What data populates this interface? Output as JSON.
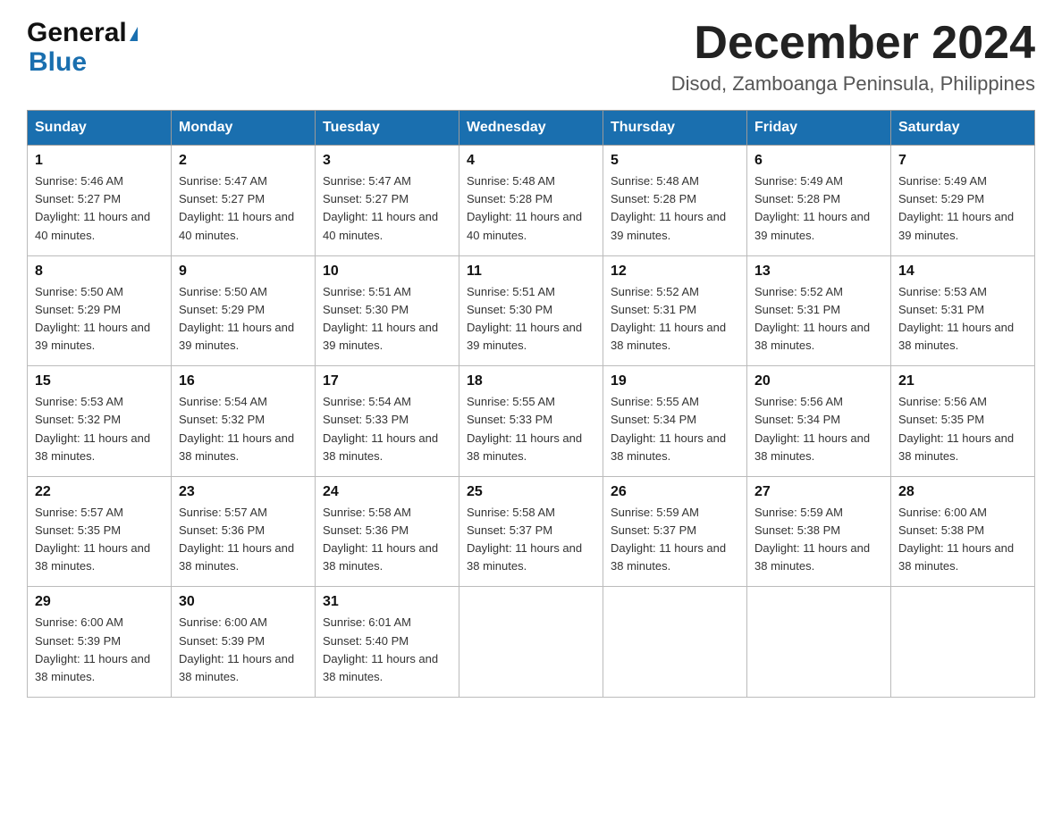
{
  "logo": {
    "general": "General",
    "blue": "Blue"
  },
  "title": "December 2024",
  "subtitle": "Disod, Zamboanga Peninsula, Philippines",
  "days_of_week": [
    "Sunday",
    "Monday",
    "Tuesday",
    "Wednesday",
    "Thursday",
    "Friday",
    "Saturday"
  ],
  "weeks": [
    [
      {
        "day": "1",
        "sunrise": "5:46 AM",
        "sunset": "5:27 PM",
        "daylight": "11 hours and 40 minutes."
      },
      {
        "day": "2",
        "sunrise": "5:47 AM",
        "sunset": "5:27 PM",
        "daylight": "11 hours and 40 minutes."
      },
      {
        "day": "3",
        "sunrise": "5:47 AM",
        "sunset": "5:27 PM",
        "daylight": "11 hours and 40 minutes."
      },
      {
        "day": "4",
        "sunrise": "5:48 AM",
        "sunset": "5:28 PM",
        "daylight": "11 hours and 40 minutes."
      },
      {
        "day": "5",
        "sunrise": "5:48 AM",
        "sunset": "5:28 PM",
        "daylight": "11 hours and 39 minutes."
      },
      {
        "day": "6",
        "sunrise": "5:49 AM",
        "sunset": "5:28 PM",
        "daylight": "11 hours and 39 minutes."
      },
      {
        "day": "7",
        "sunrise": "5:49 AM",
        "sunset": "5:29 PM",
        "daylight": "11 hours and 39 minutes."
      }
    ],
    [
      {
        "day": "8",
        "sunrise": "5:50 AM",
        "sunset": "5:29 PM",
        "daylight": "11 hours and 39 minutes."
      },
      {
        "day": "9",
        "sunrise": "5:50 AM",
        "sunset": "5:29 PM",
        "daylight": "11 hours and 39 minutes."
      },
      {
        "day": "10",
        "sunrise": "5:51 AM",
        "sunset": "5:30 PM",
        "daylight": "11 hours and 39 minutes."
      },
      {
        "day": "11",
        "sunrise": "5:51 AM",
        "sunset": "5:30 PM",
        "daylight": "11 hours and 39 minutes."
      },
      {
        "day": "12",
        "sunrise": "5:52 AM",
        "sunset": "5:31 PM",
        "daylight": "11 hours and 38 minutes."
      },
      {
        "day": "13",
        "sunrise": "5:52 AM",
        "sunset": "5:31 PM",
        "daylight": "11 hours and 38 minutes."
      },
      {
        "day": "14",
        "sunrise": "5:53 AM",
        "sunset": "5:31 PM",
        "daylight": "11 hours and 38 minutes."
      }
    ],
    [
      {
        "day": "15",
        "sunrise": "5:53 AM",
        "sunset": "5:32 PM",
        "daylight": "11 hours and 38 minutes."
      },
      {
        "day": "16",
        "sunrise": "5:54 AM",
        "sunset": "5:32 PM",
        "daylight": "11 hours and 38 minutes."
      },
      {
        "day": "17",
        "sunrise": "5:54 AM",
        "sunset": "5:33 PM",
        "daylight": "11 hours and 38 minutes."
      },
      {
        "day": "18",
        "sunrise": "5:55 AM",
        "sunset": "5:33 PM",
        "daylight": "11 hours and 38 minutes."
      },
      {
        "day": "19",
        "sunrise": "5:55 AM",
        "sunset": "5:34 PM",
        "daylight": "11 hours and 38 minutes."
      },
      {
        "day": "20",
        "sunrise": "5:56 AM",
        "sunset": "5:34 PM",
        "daylight": "11 hours and 38 minutes."
      },
      {
        "day": "21",
        "sunrise": "5:56 AM",
        "sunset": "5:35 PM",
        "daylight": "11 hours and 38 minutes."
      }
    ],
    [
      {
        "day": "22",
        "sunrise": "5:57 AM",
        "sunset": "5:35 PM",
        "daylight": "11 hours and 38 minutes."
      },
      {
        "day": "23",
        "sunrise": "5:57 AM",
        "sunset": "5:36 PM",
        "daylight": "11 hours and 38 minutes."
      },
      {
        "day": "24",
        "sunrise": "5:58 AM",
        "sunset": "5:36 PM",
        "daylight": "11 hours and 38 minutes."
      },
      {
        "day": "25",
        "sunrise": "5:58 AM",
        "sunset": "5:37 PM",
        "daylight": "11 hours and 38 minutes."
      },
      {
        "day": "26",
        "sunrise": "5:59 AM",
        "sunset": "5:37 PM",
        "daylight": "11 hours and 38 minutes."
      },
      {
        "day": "27",
        "sunrise": "5:59 AM",
        "sunset": "5:38 PM",
        "daylight": "11 hours and 38 minutes."
      },
      {
        "day": "28",
        "sunrise": "6:00 AM",
        "sunset": "5:38 PM",
        "daylight": "11 hours and 38 minutes."
      }
    ],
    [
      {
        "day": "29",
        "sunrise": "6:00 AM",
        "sunset": "5:39 PM",
        "daylight": "11 hours and 38 minutes."
      },
      {
        "day": "30",
        "sunrise": "6:00 AM",
        "sunset": "5:39 PM",
        "daylight": "11 hours and 38 minutes."
      },
      {
        "day": "31",
        "sunrise": "6:01 AM",
        "sunset": "5:40 PM",
        "daylight": "11 hours and 38 minutes."
      },
      null,
      null,
      null,
      null
    ]
  ]
}
